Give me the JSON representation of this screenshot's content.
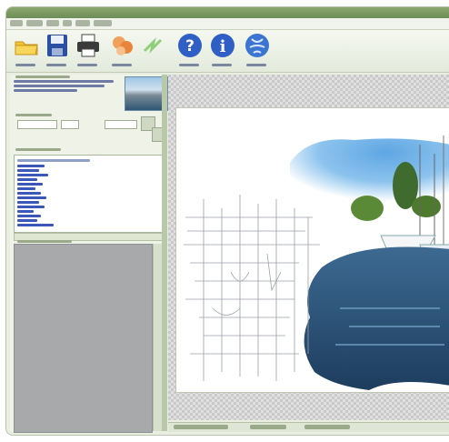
{
  "colors": {
    "title_bar": "#7a9a62",
    "accent_green": "#b9c8a8",
    "help_blue": "#2f5fc4",
    "link_blue": "#3b57b7"
  },
  "toolbar": {
    "buttons": [
      {
        "icon": "open-folder-icon"
      },
      {
        "icon": "save-disk-icon"
      },
      {
        "icon": "printer-icon"
      },
      {
        "icon": "photos-icon"
      },
      {
        "icon": "arrow-icon"
      },
      {
        "icon": "help-icon"
      },
      {
        "icon": "info-icon"
      },
      {
        "icon": "web-globe-icon"
      }
    ]
  },
  "left_panel": {
    "effect_list": {
      "item_count": 15
    },
    "preview_image": "harbour-thumbnail"
  },
  "canvas": {
    "background": "transparency-checkerboard",
    "image": "harbour-photo-sketch-effect"
  }
}
